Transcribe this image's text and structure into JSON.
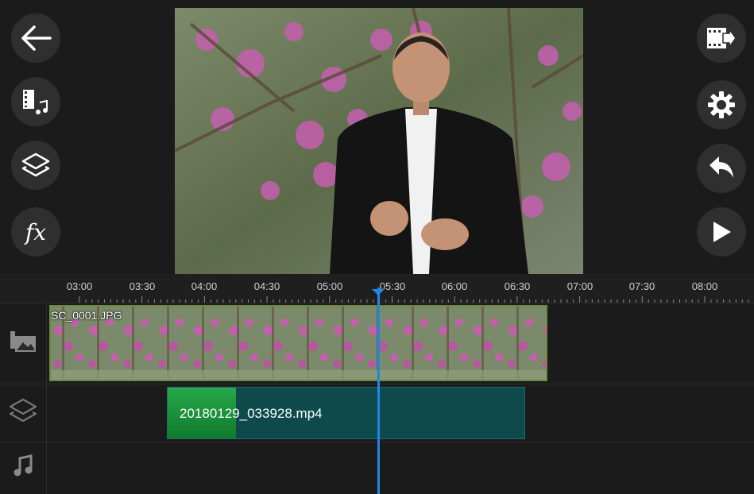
{
  "left_toolbar": {
    "back_icon": "arrow-left-icon",
    "media_icon": "media-library-icon",
    "layers_icon": "layers-icon",
    "effects_label": "fx"
  },
  "right_toolbar": {
    "export_icon": "export-video-icon",
    "settings_icon": "gear-icon",
    "undo_icon": "undo-icon",
    "play_icon": "play-icon"
  },
  "timeline": {
    "ruler_ticks": [
      "03:00",
      "03:30",
      "04:00",
      "04:30",
      "05:00",
      "05:30",
      "06:00",
      "06:30",
      "07:00",
      "07:30",
      "08:00"
    ],
    "tracks": {
      "photo": {
        "icon": "image-track-icon",
        "clip_label": "SC_0001.JPG"
      },
      "overlay": {
        "icon": "layers-track-icon",
        "clip_label": "20180129_033928.mp4"
      },
      "audio": {
        "icon": "music-track-icon"
      }
    },
    "colors": {
      "playhead": "#1e88e5",
      "video_clip": "#0e4a4c",
      "photo_clip_border": "#6f8a3f"
    }
  }
}
